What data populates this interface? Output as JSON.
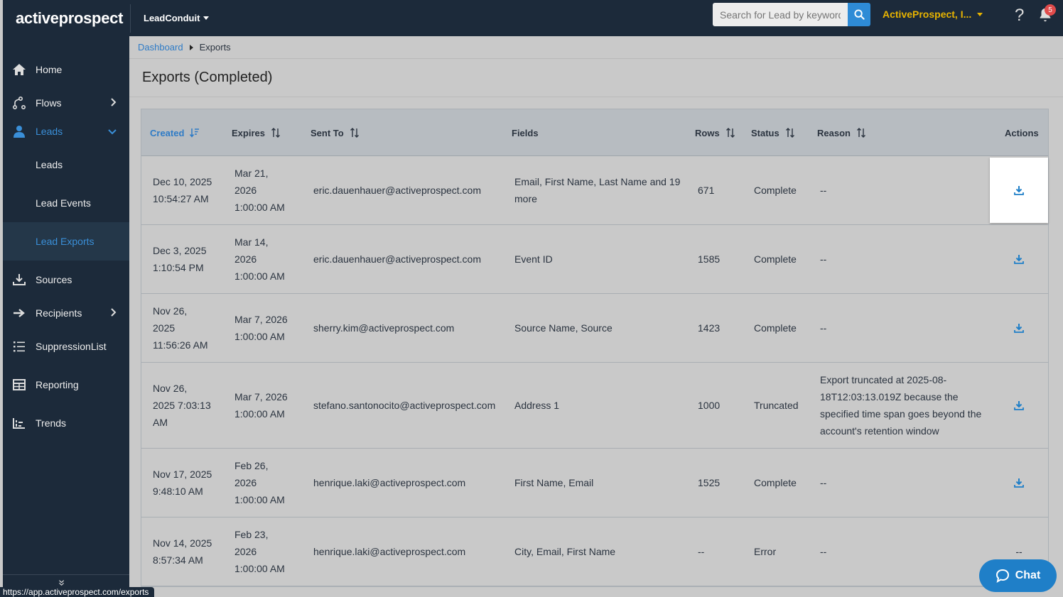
{
  "topbar": {
    "logo": "activeprospect",
    "product": "LeadConduit",
    "search_placeholder": "Search for Lead by keyword",
    "account": "ActiveProspect, I...",
    "help": "?",
    "notification_count": "5",
    "accent_color": "#e8b400"
  },
  "sidebar": {
    "home": "Home",
    "flows": "Flows",
    "leads": "Leads",
    "leads_sub": "Leads",
    "lead_events": "Lead Events",
    "lead_exports": "Lead Exports",
    "sources": "Sources",
    "recipients": "Recipients",
    "suppression": "SuppressionList",
    "reporting": "Reporting",
    "trends": "Trends",
    "collapse": "»"
  },
  "breadcrumb": {
    "home": "Dashboard",
    "current": "Exports"
  },
  "page_title": "Exports (Completed)",
  "table": {
    "headers": {
      "created": "Created",
      "expires": "Expires",
      "sent_to": "Sent To",
      "fields": "Fields",
      "rows": "Rows",
      "status": "Status",
      "reason": "Reason",
      "actions": "Actions"
    },
    "rows": [
      {
        "created1": "Dec 10, 2025",
        "created2": "10:54:27 AM",
        "created3": "",
        "expires1": "Mar 21,",
        "expires2": "2026",
        "expires3": "1:00:00 AM",
        "sent_to": "eric.dauenhauer@activeprospect.com",
        "fields1": "Email, First Name, Last Name and 19",
        "fields2": "more",
        "rows": "671",
        "status": "Complete",
        "reason1": "--",
        "reason2": "",
        "reason3": "",
        "reason4": "",
        "action": "download"
      },
      {
        "created1": "Dec 3, 2025",
        "created2": "1:10:54 PM",
        "created3": "",
        "expires1": "Mar 14,",
        "expires2": "2026",
        "expires3": "1:00:00 AM",
        "sent_to": "eric.dauenhauer@activeprospect.com",
        "fields1": "Event ID",
        "fields2": "",
        "rows": "1585",
        "status": "Complete",
        "reason1": "--",
        "reason2": "",
        "reason3": "",
        "reason4": "",
        "action": "download"
      },
      {
        "created1": "Nov 26,",
        "created2": "2025",
        "created3": "11:56:26 AM",
        "expires1": "Mar 7, 2026",
        "expires2": "1:00:00 AM",
        "expires3": "",
        "sent_to": "sherry.kim@activeprospect.com",
        "fields1": "Source Name, Source",
        "fields2": "",
        "rows": "1423",
        "status": "Complete",
        "reason1": "--",
        "reason2": "",
        "reason3": "",
        "reason4": "",
        "action": "download"
      },
      {
        "created1": "Nov 26,",
        "created2": "2025 7:03:13",
        "created3": "AM",
        "expires1": "Mar 7, 2026",
        "expires2": "1:00:00 AM",
        "expires3": "",
        "sent_to": "stefano.santonocito@activeprospect.com",
        "fields1": "Address 1",
        "fields2": "",
        "rows": "1000",
        "status": "Truncated",
        "reason1": "Export truncated at 2025-08-",
        "reason2": "18T12:03:13.019Z because the",
        "reason3": "specified time span goes beyond the",
        "reason4": "account's retention window",
        "action": "download"
      },
      {
        "created1": "Nov 17, 2025",
        "created2": "9:48:10 AM",
        "created3": "",
        "expires1": "Feb 26,",
        "expires2": "2026",
        "expires3": "1:00:00 AM",
        "sent_to": "henrique.laki@activeprospect.com",
        "fields1": "First Name, Email",
        "fields2": "",
        "rows": "1525",
        "status": "Complete",
        "reason1": "--",
        "reason2": "",
        "reason3": "",
        "reason4": "",
        "action": "download"
      },
      {
        "created1": "Nov 14, 2025",
        "created2": "8:57:34 AM",
        "created3": "",
        "expires1": "Feb 23,",
        "expires2": "2026",
        "expires3": "1:00:00 AM",
        "sent_to": "henrique.laki@activeprospect.com",
        "fields1": "City, Email, First Name",
        "fields2": "",
        "rows": "--",
        "status": "Error",
        "reason1": "--",
        "reason2": "",
        "reason3": "",
        "reason4": "",
        "action": "--"
      }
    ]
  },
  "chat": {
    "label": "Chat"
  },
  "status_url": "https://app.activeprospect.com/exports"
}
